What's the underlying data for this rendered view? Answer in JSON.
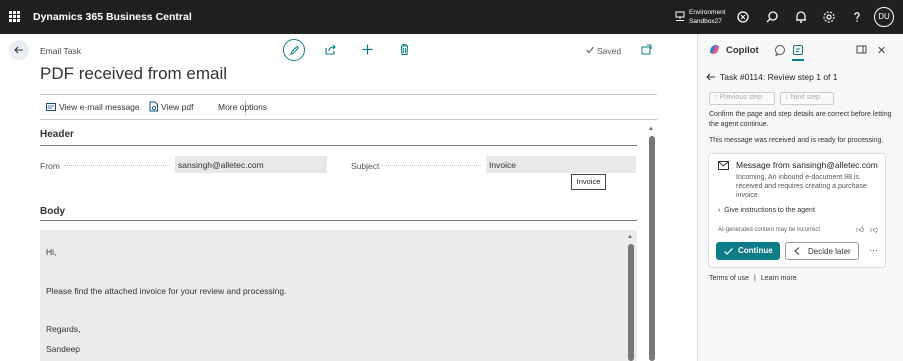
{
  "topbar": {
    "app_title": "Dynamics 365 Business Central",
    "environment_label": "Environment",
    "environment_name": "Sandbox27",
    "icons": [
      "waffle-icon",
      "environment-icon",
      "copilot-icon",
      "search-icon",
      "bell-icon",
      "gear-icon",
      "help-icon"
    ],
    "avatar_initials": "DU"
  },
  "page": {
    "breadcrumb": "Email Task",
    "title": "PDF received from email",
    "saved_label": "Saved",
    "actions": {
      "view_email": "View e-mail message",
      "view_pdf": "View pdf",
      "more_options": "More options"
    }
  },
  "header_section": {
    "title": "Header",
    "from_label": "From",
    "from_value": "sansingh@alletec.com",
    "subject_label": "Subject",
    "subject_value": "Invoice",
    "tooltip": "Invoice"
  },
  "body_section": {
    "title": "Body",
    "lines": [
      "Hi,",
      "Please find the attached invoice for your review and processing.",
      "Regards,",
      "Sandeep"
    ]
  },
  "copilot": {
    "title": "Copilot",
    "task_title": "Task #0114: Review step 1 of 1",
    "prev_step": "Previous step",
    "next_step": "Next step",
    "instruction": "Confirm the page and step details are correct before letting the agent continue.",
    "status": "This message was received and is ready for processing.",
    "card": {
      "title": "Message from sansingh@alletec.com",
      "body": "Incoming. An inbound e-document 98 is received and requires creating a purchase invoice.",
      "give_instructions": "Give instructions to the agent",
      "disclaimer": "AI-generated content may be incorrect",
      "continue_label": "Continue",
      "decide_later_label": "Decide later"
    },
    "terms": "Terms of use",
    "separator": "|",
    "learn_more": "Learn more"
  },
  "colors": {
    "topbar": "#202020",
    "accent": "#0e7c86"
  }
}
